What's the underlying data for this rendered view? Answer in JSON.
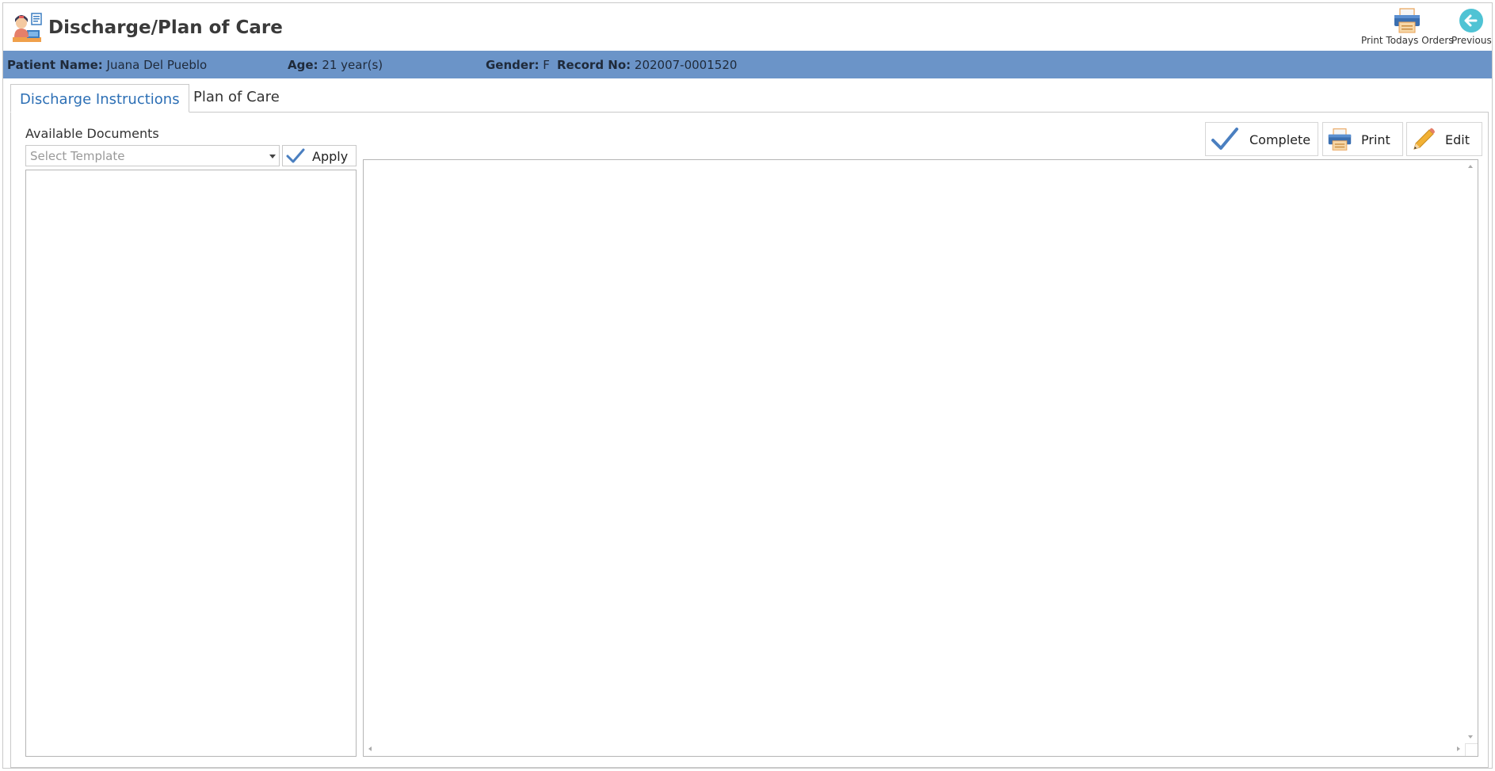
{
  "header": {
    "title": "Discharge/Plan of Care",
    "actions": {
      "print_orders": "Print Todays Orders",
      "previous": "Previous"
    }
  },
  "patient": {
    "name_label": "Patient Name:",
    "name": "Juana Del Pueblo",
    "age_label": "Age:",
    "age": "21 year(s)",
    "gender_label": "Gender:",
    "gender": "F",
    "record_label": "Record No:",
    "record": "202007-0001520"
  },
  "tabs": [
    {
      "label": "Discharge Instructions",
      "active": true
    },
    {
      "label": "Plan of Care",
      "active": false
    }
  ],
  "left_panel": {
    "available_label": "Available Documents",
    "template_placeholder": "Select Template",
    "apply_label": "Apply"
  },
  "toolbar": {
    "complete_label": "Complete",
    "print_label": "Print",
    "edit_label": "Edit"
  },
  "colors": {
    "banner": "#6b94c8",
    "active_tab": "#2c6fb5",
    "check": "#4a7fc0"
  }
}
